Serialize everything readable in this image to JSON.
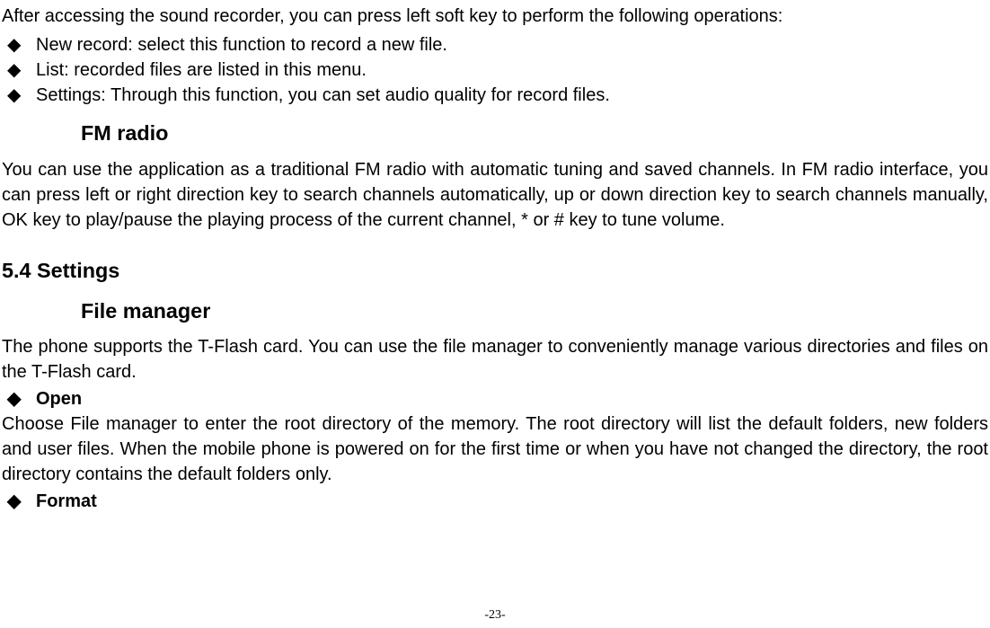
{
  "intro": "After accessing the sound recorder, you can press left soft key to perform the following operations:",
  "recorder_bullets": [
    "New record: select this function to record a new file.",
    "List: recorded files are listed in this menu.",
    "Settings: Through this function, you can set audio quality for record files."
  ],
  "fm_heading": "FM radio",
  "fm_paragraph": "You can use the application as a traditional FM radio with automatic tuning and saved channels. In FM radio interface, you can press left or right direction key to search channels automatically, up or down direction key to search channels manually, OK key to play/pause the playing process of the current channel, * or # key to tune volume.",
  "settings_heading": "5.4 Settings",
  "file_manager_heading": "File manager",
  "file_manager_paragraph": "The phone supports the T-Flash card. You can use the file manager to conveniently manage various directories and files on the T-Flash card.",
  "open_label": "Open",
  "open_paragraph": "Choose File manager to enter the root directory of the memory. The root directory will list the default folders, new folders and user files. When the mobile phone is powered on for the first time or when you have not changed the directory, the root directory contains the default folders only.",
  "format_label": "Format",
  "page_number": "-23-"
}
